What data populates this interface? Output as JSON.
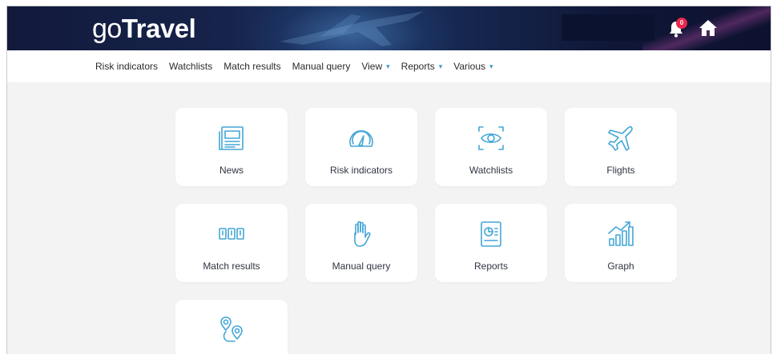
{
  "app": {
    "logo_prefix": "go",
    "logo_suffix": "Travel",
    "notification_count": "0"
  },
  "nav": {
    "items": [
      {
        "label": "Risk indicators"
      },
      {
        "label": "Watchlists"
      },
      {
        "label": "Match results"
      },
      {
        "label": "Manual query"
      },
      {
        "label": "View",
        "dropdown": true
      },
      {
        "label": "Reports",
        "dropdown": true
      },
      {
        "label": "Various",
        "dropdown": true
      }
    ],
    "caret": "▾"
  },
  "tiles": [
    {
      "label": "News",
      "icon": "newspaper-icon"
    },
    {
      "label": "Risk indicators",
      "icon": "gauge-icon"
    },
    {
      "label": "Watchlists",
      "icon": "eye-scan-icon"
    },
    {
      "label": "Flights",
      "icon": "airplane-icon"
    },
    {
      "label": "Match results",
      "icon": "bars-match-icon"
    },
    {
      "label": "Manual query",
      "icon": "hand-icon"
    },
    {
      "label": "Reports",
      "icon": "report-icon"
    },
    {
      "label": "Graph",
      "icon": "growth-chart-icon"
    },
    {
      "label": "",
      "icon": "route-pins-icon"
    }
  ],
  "colors": {
    "accent": "#43a6d6",
    "header_bg": "#121a3c",
    "badge": "#e8274d",
    "page_bg": "#f3f3f4"
  }
}
